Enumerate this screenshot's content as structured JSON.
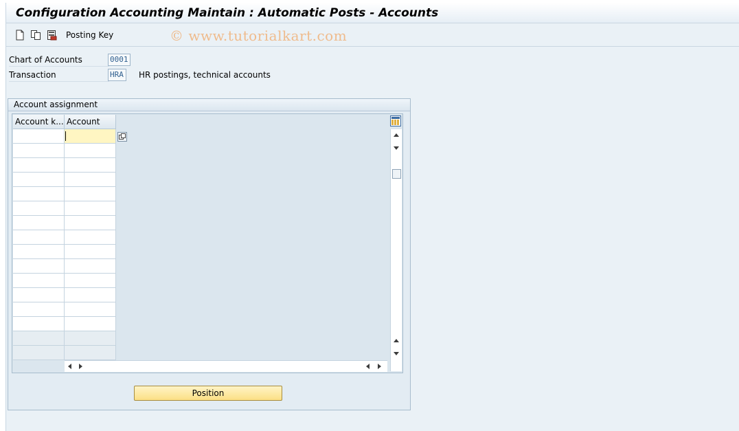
{
  "title": "Configuration Accounting Maintain : Automatic Posts - Accounts",
  "toolbar": {
    "icons": [
      "new-entries-icon",
      "copy-icon",
      "save-variant-icon"
    ],
    "posting_key_label": "Posting Key"
  },
  "watermark": "© www.tutorialkart.com",
  "form": {
    "chart_of_accounts_label": "Chart of Accounts",
    "chart_of_accounts_value": "0001",
    "transaction_label": "Transaction",
    "transaction_value": "HRA",
    "transaction_desc": "HR postings, technical accounts"
  },
  "account_assignment": {
    "title": "Account assignment",
    "columns": [
      "Account k...",
      "Account"
    ],
    "rows": [
      [
        "",
        ""
      ],
      [
        "",
        ""
      ],
      [
        "",
        ""
      ],
      [
        "",
        ""
      ],
      [
        "",
        ""
      ],
      [
        "",
        ""
      ],
      [
        "",
        ""
      ],
      [
        "",
        ""
      ],
      [
        "",
        ""
      ],
      [
        "",
        ""
      ],
      [
        "",
        ""
      ],
      [
        "",
        ""
      ],
      [
        "",
        ""
      ],
      [
        "",
        ""
      ],
      [
        "",
        ""
      ],
      [
        "",
        ""
      ]
    ]
  },
  "position_button_label": "Position",
  "colors": {
    "background": "#eaf1f6",
    "active_cell": "#fff6c2",
    "button": "#fbdf85",
    "field_text": "#2f5f8f"
  }
}
